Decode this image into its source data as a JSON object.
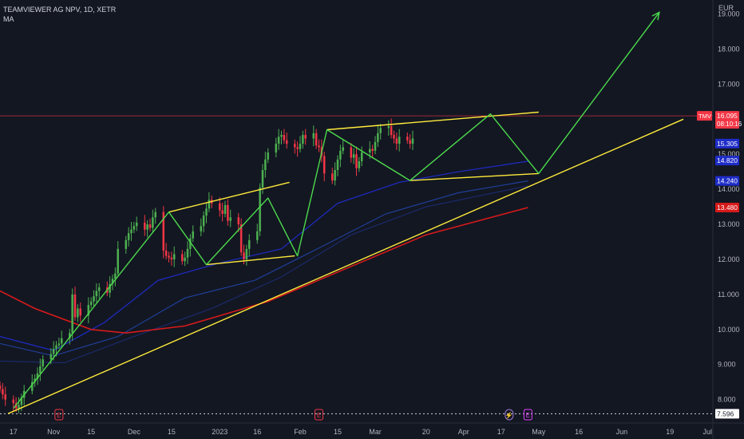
{
  "header": {
    "symbol_line": "TEAMVIEWER AG NPV, 1D, XETR",
    "indicator": "MA"
  },
  "axis": {
    "currency": "EUR"
  },
  "colors": {
    "background": "#131722",
    "up": "#4caf50",
    "down": "#f23645",
    "ma_fast": "#1e2cc8",
    "ma_mid": "#1f3f9a",
    "ma_slow": "#1b2a6b",
    "ma_long": "#d61a1a",
    "pattern": "#ffeb3b",
    "path": "#4cd94c",
    "price_line": "#f23645"
  },
  "chart_data": {
    "type": "candlestick",
    "title": "TEAMVIEWER AG NPV, 1D, XETR",
    "ylabel": "EUR",
    "ylim": [
      7.4,
      19.4
    ],
    "xlim": [
      "2022-10-12",
      "2023-07-05"
    ],
    "y_ticks": [
      "8.000",
      "9.000",
      "10.000",
      "11.000",
      "12.000",
      "13.000",
      "14.000",
      "15.000",
      "16.000",
      "17.000",
      "18.000",
      "19.000"
    ],
    "x_ticks": [
      {
        "label": "17",
        "date": "2022-10-17"
      },
      {
        "label": "Nov",
        "date": "2022-11-01"
      },
      {
        "label": "15",
        "date": "2022-11-15"
      },
      {
        "label": "Dec",
        "date": "2022-12-01"
      },
      {
        "label": "15",
        "date": "2022-12-15"
      },
      {
        "label": "2023",
        "date": "2023-01-02"
      },
      {
        "label": "16",
        "date": "2023-01-16"
      },
      {
        "label": "Feb",
        "date": "2023-02-01"
      },
      {
        "label": "15",
        "date": "2023-02-15"
      },
      {
        "label": "Mar",
        "date": "2023-03-01"
      },
      {
        "label": "20",
        "date": "2023-03-20"
      },
      {
        "label": "Apr",
        "date": "2023-04-03"
      },
      {
        "label": "17",
        "date": "2023-04-17"
      },
      {
        "label": "May",
        "date": "2023-05-01"
      },
      {
        "label": "16",
        "date": "2023-05-16"
      },
      {
        "label": "Jun",
        "date": "2023-06-01"
      },
      {
        "label": "19",
        "date": "2023-06-19"
      },
      {
        "label": "Jul",
        "date": "2023-07-03"
      }
    ],
    "price_labels": [
      {
        "text": "16.095",
        "sub": "08:10:16",
        "value": 16.095,
        "tag": "TMV",
        "color": "#f23645"
      },
      {
        "text": "15.305",
        "value": 15.305,
        "color": "#1e2cc8"
      },
      {
        "text": "14.820",
        "value": 14.82,
        "color": "#1e2cc8"
      },
      {
        "text": "14.240",
        "value": 14.24,
        "color": "#1e2cc8"
      },
      {
        "text": "13.480",
        "value": 13.48,
        "color": "#d61a1a"
      },
      {
        "text": "7.596",
        "value": 7.596,
        "color": "#ffffff"
      }
    ],
    "current_price": 16.095,
    "low_line": 7.596,
    "candles_series": [
      8.3,
      8.15,
      8.0,
      7.9,
      7.75,
      7.85,
      8.05,
      8.25,
      8.5,
      8.6,
      8.75,
      8.95,
      9.15,
      9.3,
      9.45,
      9.55,
      9.6,
      9.75,
      9.9,
      11.0,
      10.35,
      10.6,
      10.4,
      10.7,
      10.8,
      10.95,
      11.1,
      11.2,
      11.05,
      11.3,
      11.45,
      11.6,
      12.3,
      12.55,
      12.75,
      12.85,
      12.95,
      13.05,
      12.85,
      13.0,
      12.9,
      13.2,
      13.35,
      12.25,
      12.1,
      12.05,
      12.0,
      12.15,
      11.95,
      12.05,
      12.3,
      12.6,
      12.8,
      12.95,
      13.25,
      13.45,
      13.7,
      13.6,
      13.4,
      13.3,
      13.55,
      13.1,
      13.2,
      13.0,
      12.2,
      12.0,
      12.3,
      12.55,
      12.8,
      14.05,
      14.55,
      14.85,
      15.05,
      15.3,
      15.5,
      15.55,
      15.4,
      15.3,
      15.2,
      15.15,
      15.3,
      15.55,
      15.45,
      15.6,
      15.25,
      15.2,
      14.95,
      14.45,
      14.25,
      14.55,
      14.85,
      15.1,
      15.2,
      14.9,
      15.0,
      14.6,
      14.8,
      15.05,
      15.15,
      15.1,
      15.35,
      15.6,
      15.75,
      15.8,
      15.55,
      15.45,
      15.3,
      15.5,
      15.4,
      15.3,
      15.45
    ],
    "moving_averages": [
      {
        "name": "MA fast",
        "color": "#1e2cc8",
        "points": [
          [
            "2022-10-12",
            9.8
          ],
          [
            "2022-11-01",
            9.4
          ],
          [
            "2022-11-20",
            10.2
          ],
          [
            "2022-12-10",
            11.4
          ],
          [
            "2023-01-02",
            11.9
          ],
          [
            "2023-01-25",
            12.3
          ],
          [
            "2023-02-15",
            13.6
          ],
          [
            "2023-03-10",
            14.2
          ],
          [
            "2023-04-01",
            14.5
          ],
          [
            "2023-04-27",
            14.8
          ]
        ]
      },
      {
        "name": "MA mid",
        "color": "#1f3f9a",
        "points": [
          [
            "2022-10-12",
            9.6
          ],
          [
            "2022-11-01",
            9.25
          ],
          [
            "2022-11-25",
            9.8
          ],
          [
            "2022-12-20",
            10.9
          ],
          [
            "2023-01-15",
            11.4
          ],
          [
            "2023-02-10",
            12.4
          ],
          [
            "2023-03-05",
            13.3
          ],
          [
            "2023-04-01",
            13.9
          ],
          [
            "2023-04-27",
            14.24
          ]
        ]
      },
      {
        "name": "MA slow",
        "color": "#1b2a6b",
        "points": [
          [
            "2022-10-12",
            9.1
          ],
          [
            "2022-11-05",
            9.05
          ],
          [
            "2022-12-01",
            9.8
          ],
          [
            "2022-12-30",
            10.6
          ],
          [
            "2023-01-25",
            11.5
          ],
          [
            "2023-02-20",
            12.7
          ],
          [
            "2023-03-20",
            13.5
          ],
          [
            "2023-04-27",
            14.1
          ]
        ]
      },
      {
        "name": "MA long",
        "color": "#d61a1a",
        "points": [
          [
            "2022-10-12",
            11.1
          ],
          [
            "2022-10-25",
            10.6
          ],
          [
            "2022-11-15",
            10.0
          ],
          [
            "2022-11-28",
            9.9
          ],
          [
            "2022-12-20",
            10.1
          ],
          [
            "2023-01-20",
            10.8
          ],
          [
            "2023-02-20",
            11.8
          ],
          [
            "2023-03-20",
            12.7
          ],
          [
            "2023-04-27",
            13.48
          ]
        ]
      }
    ],
    "drawings": [
      {
        "kind": "trendline",
        "color": "#ffeb3b",
        "points": [
          [
            "2022-10-15",
            7.6
          ],
          [
            "2023-06-24",
            16.0
          ]
        ]
      },
      {
        "kind": "trendline",
        "color": "#ffeb3b",
        "points": [
          [
            "2022-12-14",
            13.35
          ],
          [
            "2023-01-28",
            14.2
          ]
        ]
      },
      {
        "kind": "trendline",
        "color": "#ffeb3b",
        "points": [
          [
            "2022-12-28",
            11.85
          ],
          [
            "2023-01-30",
            12.1
          ]
        ]
      },
      {
        "kind": "trendline",
        "color": "#ffeb3b",
        "points": [
          [
            "2023-02-11",
            15.7
          ],
          [
            "2023-05-01",
            16.2
          ]
        ]
      },
      {
        "kind": "trendline",
        "color": "#ffeb3b",
        "points": [
          [
            "2023-03-14",
            14.25
          ],
          [
            "2023-05-01",
            14.45
          ]
        ]
      },
      {
        "kind": "path",
        "color": "#4cd94c",
        "arrow": true,
        "points": [
          [
            "2022-10-17",
            7.75
          ],
          [
            "2022-12-14",
            13.35
          ],
          [
            "2022-12-28",
            11.85
          ],
          [
            "2023-01-20",
            13.75
          ],
          [
            "2023-01-31",
            12.1
          ],
          [
            "2023-02-11",
            15.7
          ],
          [
            "2023-03-14",
            14.25
          ],
          [
            "2023-04-13",
            16.15
          ],
          [
            "2023-05-01",
            14.45
          ],
          [
            "2023-06-15",
            19.05
          ]
        ]
      }
    ]
  }
}
